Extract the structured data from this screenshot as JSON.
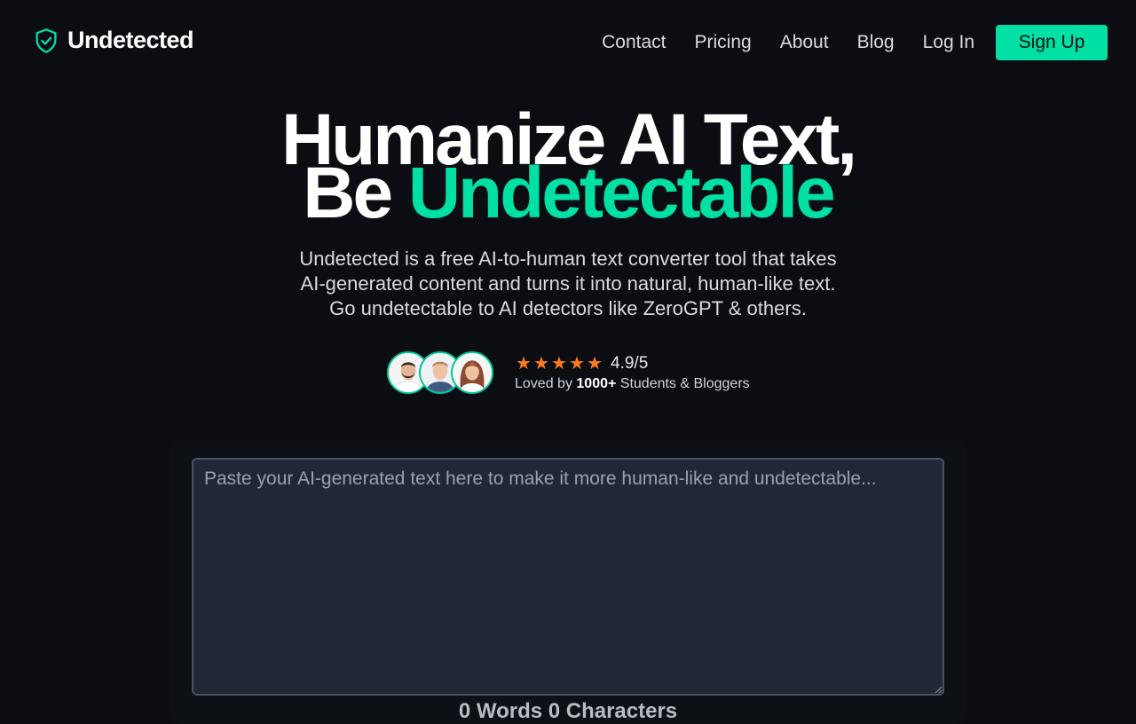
{
  "brand": {
    "name": "Undetected",
    "icon": "shield-check-icon",
    "accent": "#00e0a4"
  },
  "nav": {
    "links": [
      "Contact",
      "Pricing",
      "About",
      "Blog"
    ],
    "login": "Log In",
    "signup": "Sign Up"
  },
  "hero": {
    "title_line1": "Humanize AI Text,",
    "title_line2_prefix": "Be ",
    "title_line2_accent": "Undetectable",
    "subtitle_lines": [
      "Undetected is a free AI-to-human text converter tool that takes",
      "AI-generated content and turns it into natural, human-like text.",
      "Go undetectable to AI detectors like ZeroGPT & others."
    ]
  },
  "social_proof": {
    "avatars": [
      "avatar-man-beard",
      "avatar-man-young",
      "avatar-woman"
    ],
    "stars": 5,
    "star_color": "#ff7a1a",
    "score": "4.9/5",
    "loved_prefix": "Loved by ",
    "loved_count": "1000+",
    "loved_suffix": " Students & Bloggers"
  },
  "editor": {
    "placeholder": "Paste your AI-generated text here to make it more human-like and undetectable...",
    "value": ""
  },
  "counter": "0 Words 0 Characters"
}
